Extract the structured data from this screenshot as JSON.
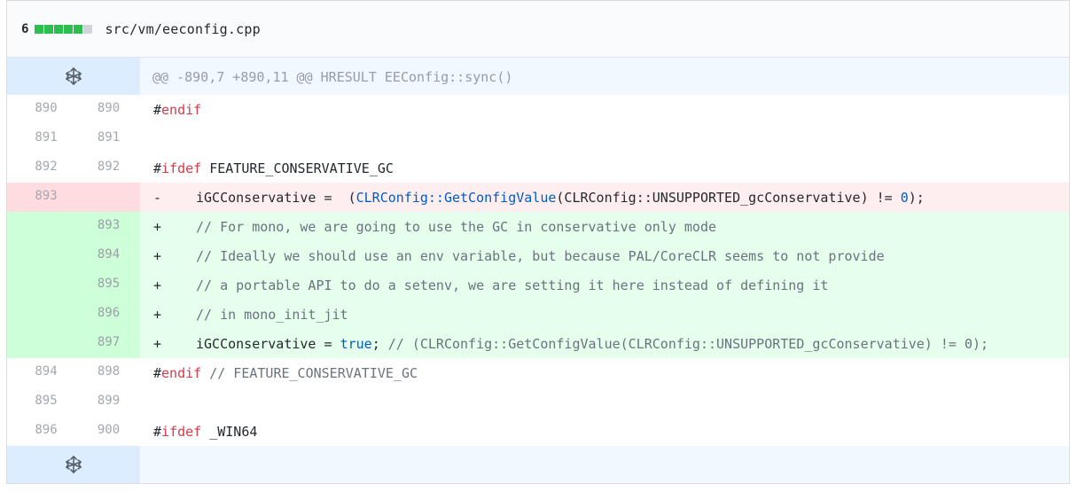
{
  "file": {
    "change_count": "6",
    "diffstat": [
      "added",
      "added",
      "added",
      "added",
      "added",
      "neutral"
    ],
    "path": "src/vm/eeconfig.cpp"
  },
  "hunk": {
    "header": "@@ -890,7 +890,11 @@ HRESULT EEConfig::sync()"
  },
  "lines": [
    {
      "type": "ctx",
      "old": "890",
      "new": "890",
      "marker": "",
      "parts": [
        {
          "c": "kw-prefix",
          "t": "#"
        },
        {
          "c": "kw",
          "t": "endif"
        }
      ]
    },
    {
      "type": "ctx",
      "old": "891",
      "new": "891",
      "marker": "",
      "parts": []
    },
    {
      "type": "ctx",
      "old": "892",
      "new": "892",
      "marker": "",
      "parts": [
        {
          "c": "",
          "t": "#"
        },
        {
          "c": "kw",
          "t": "ifdef"
        },
        {
          "c": "",
          "t": " FEATURE_CONSERVATIVE_GC"
        }
      ]
    },
    {
      "type": "del",
      "old": "893",
      "new": "",
      "marker": "-",
      "parts": [
        {
          "c": "",
          "t": "iGCConservative =  ("
        },
        {
          "c": "fn",
          "t": "CLRConfig::GetConfigValue"
        },
        {
          "c": "",
          "t": "(CLRConfig::UNSUPPORTED_gcConservative) != "
        },
        {
          "c": "hl",
          "t": "0"
        },
        {
          "c": "",
          "t": ");"
        }
      ]
    },
    {
      "type": "add",
      "old": "",
      "new": "893",
      "marker": "+",
      "parts": [
        {
          "c": "cm",
          "t": "// For mono, we are going to use the GC in conservative only mode"
        }
      ]
    },
    {
      "type": "add",
      "old": "",
      "new": "894",
      "marker": "+",
      "parts": [
        {
          "c": "cm",
          "t": "// Ideally we should use an env variable, but because PAL/CoreCLR seems to not provide"
        }
      ]
    },
    {
      "type": "add",
      "old": "",
      "new": "895",
      "marker": "+",
      "parts": [
        {
          "c": "cm",
          "t": "// a portable API to do a setenv, we are setting it here instead of defining it"
        }
      ]
    },
    {
      "type": "add",
      "old": "",
      "new": "896",
      "marker": "+",
      "parts": [
        {
          "c": "cm",
          "t": "// in mono_init_jit"
        }
      ]
    },
    {
      "type": "add",
      "old": "",
      "new": "897",
      "marker": "+",
      "parts": [
        {
          "c": "",
          "t": "iGCConservative = "
        },
        {
          "c": "hl",
          "t": "true"
        },
        {
          "c": "",
          "t": "; "
        },
        {
          "c": "cm",
          "t": "// (CLRConfig::GetConfigValue(CLRConfig::UNSUPPORTED_gcConservative) != 0);"
        }
      ]
    },
    {
      "type": "ctx",
      "old": "894",
      "new": "898",
      "marker": "",
      "parts": [
        {
          "c": "",
          "t": "#"
        },
        {
          "c": "kw",
          "t": "endif"
        },
        {
          "c": "cm",
          "t": " // FEATURE_CONSERVATIVE_GC"
        }
      ]
    },
    {
      "type": "ctx",
      "old": "895",
      "new": "899",
      "marker": "",
      "parts": []
    },
    {
      "type": "ctx",
      "old": "896",
      "new": "900",
      "marker": "",
      "parts": [
        {
          "c": "",
          "t": "#"
        },
        {
          "c": "kw",
          "t": "ifdef"
        },
        {
          "c": "",
          "t": " _WIN64"
        }
      ]
    }
  ],
  "icons": {
    "expand_top": "unfold-icon",
    "expand_bottom": "unfold-icon"
  }
}
